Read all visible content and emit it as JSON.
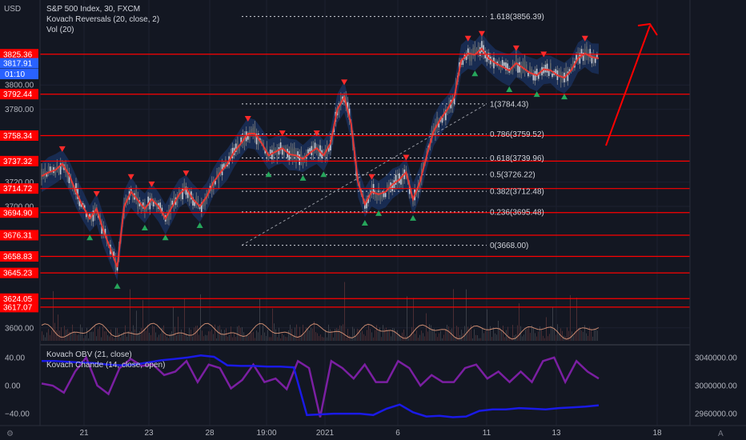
{
  "header": {
    "currency": "USD",
    "title": "S&P 500 Index, 30, FXCM",
    "indicator1": "Kovach Reversals (20, close, 2)",
    "indicator2": "Vol (20)",
    "lower_ind1": "Kovach OBV (21, close)",
    "lower_ind2": "Kovach Chande (14, close, open)"
  },
  "price_tags": {
    "last": "3817.91",
    "countdown": "01:10"
  },
  "footer": {
    "tv_logo": "TradingView-logo",
    "auto_label": "A"
  },
  "colors": {
    "bg": "#131722",
    "level": "#ff0000",
    "candle_up": "#5f6468",
    "band": "#1e3c78",
    "ma": "#e53935",
    "obv": "#1a1ae6",
    "chande": "#7b1fa2"
  },
  "chart_data": [
    {
      "type": "line",
      "title": "S&P 500 Index, 30, FXCM",
      "ylim": [
        3588,
        3870
      ],
      "y_ticks": [
        3600,
        3700,
        3720,
        3780,
        3800
      ],
      "y_tick_labels": [
        "3600.00",
        "3700.00",
        "3720.00",
        "3780.00",
        "3800.00"
      ],
      "x_tick_labels": [
        "21",
        "23",
        "28",
        "19:00",
        "2021",
        "6",
        "11",
        "13",
        "18"
      ],
      "horizontal_levels": [
        3825.36,
        3792.44,
        3758.34,
        3737.32,
        3714.72,
        3694.9,
        3676.31,
        3658.83,
        3645.23,
        3624.05,
        3617.07
      ],
      "level_labels": [
        "3825.36",
        "3792.44",
        "3758.34",
        "3737.32",
        "3714.72",
        "3694.90",
        "3676.31",
        "3658.83",
        "3645.23",
        "3624.05",
        "3617.07"
      ],
      "fibonacci": [
        {
          "ratio": 1.618,
          "value": 3856.39,
          "label": "1.618(3856.39)"
        },
        {
          "ratio": 1,
          "value": 3784.43,
          "label": "1(3784.43)"
        },
        {
          "ratio": 0.786,
          "value": 3759.52,
          "label": "0.786(3759.52)"
        },
        {
          "ratio": 0.618,
          "value": 3739.96,
          "label": "0.618(3739.96)"
        },
        {
          "ratio": 0.5,
          "value": 3726.22,
          "label": "0.5(3726.22)"
        },
        {
          "ratio": 0.382,
          "value": 3712.48,
          "label": "0.382(3712.48)"
        },
        {
          "ratio": 0.236,
          "value": 3695.48,
          "label": "0.236(3695.48)"
        },
        {
          "ratio": 0,
          "value": 3668.0,
          "label": "0(3668.00)"
        }
      ],
      "series": [
        {
          "values": [
            3725,
            3728,
            3730,
            3735,
            3726,
            3712,
            3700,
            3690,
            3698,
            3680,
            3665,
            3650,
            3700,
            3712,
            3705,
            3698,
            3706,
            3700,
            3690,
            3700,
            3710,
            3715,
            3706,
            3700,
            3708,
            3720,
            3728,
            3735,
            3745,
            3752,
            3760,
            3760,
            3752,
            3742,
            3745,
            3748,
            3743,
            3742,
            3739,
            3744,
            3748,
            3742,
            3752,
            3780,
            3790,
            3768,
            3720,
            3702,
            3712,
            3710,
            3712,
            3718,
            3722,
            3728,
            3706,
            3720,
            3742,
            3762,
            3772,
            3780,
            3790,
            3820,
            3826,
            3825,
            3830,
            3822,
            3818,
            3815,
            3812,
            3818,
            3814,
            3810,
            3808,
            3813,
            3812,
            3808,
            3806,
            3812,
            3822,
            3826,
            3823,
            3822
          ]
        }
      ]
    },
    {
      "type": "line",
      "ylim": [
        -57,
        57
      ],
      "y_ticks": [
        40,
        0,
        -40
      ],
      "y_tick_labels": [
        "40.00",
        "0.00",
        "−40.00"
      ],
      "right_ylim": [
        2943000,
        3057000
      ],
      "right_ticks": [
        3040000,
        3000000,
        2960000
      ],
      "right_tick_labels": [
        "3040000.00",
        "3000000.00",
        "2960000.00"
      ],
      "series": [
        {
          "name": "Kovach OBV (21, close)",
          "values": [
            3035000,
            3035000,
            3034000,
            3033000,
            3032000,
            3030000,
            3029000,
            3030000,
            3033000,
            3036000,
            3038000,
            3040000,
            3043000,
            3041000,
            3029000,
            3028000,
            3028000,
            3027000,
            3027000,
            3026000,
            2958000,
            2959000,
            2960000,
            2960000,
            2960000,
            2958000,
            2967000,
            2973000,
            2962000,
            2956000,
            2957000,
            2955000,
            2956000,
            2964000,
            2966000,
            2966000,
            2968000,
            2967000,
            2966000,
            2968000,
            2969000,
            2970000,
            2972000
          ]
        },
        {
          "name": "Kovach Chande (14, close, open)",
          "values": [
            3,
            0,
            -10,
            20,
            40,
            0,
            -12,
            25,
            38,
            28,
            30,
            15,
            20,
            35,
            5,
            30,
            25,
            -4,
            8,
            30,
            5,
            10,
            -5,
            35,
            25,
            -45,
            35,
            25,
            10,
            30,
            5,
            5,
            35,
            25,
            0,
            15,
            5,
            5,
            25,
            30,
            10,
            20,
            5,
            20,
            5,
            35,
            40,
            5,
            35,
            20,
            10
          ]
        }
      ]
    }
  ]
}
